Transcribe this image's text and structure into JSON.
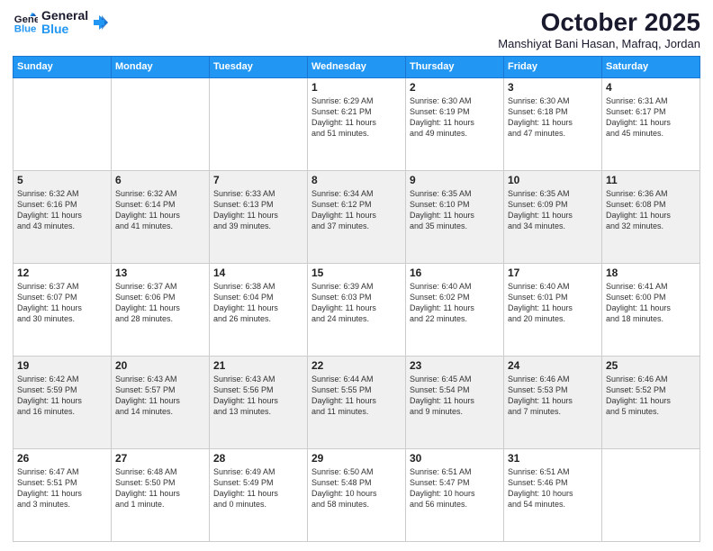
{
  "logo": {
    "line1": "General",
    "line2": "Blue"
  },
  "title": "October 2025",
  "subtitle": "Manshiyat Bani Hasan, Mafraq, Jordan",
  "weekdays": [
    "Sunday",
    "Monday",
    "Tuesday",
    "Wednesday",
    "Thursday",
    "Friday",
    "Saturday"
  ],
  "weeks": [
    [
      {
        "day": "",
        "info": ""
      },
      {
        "day": "",
        "info": ""
      },
      {
        "day": "",
        "info": ""
      },
      {
        "day": "1",
        "info": "Sunrise: 6:29 AM\nSunset: 6:21 PM\nDaylight: 11 hours\nand 51 minutes."
      },
      {
        "day": "2",
        "info": "Sunrise: 6:30 AM\nSunset: 6:19 PM\nDaylight: 11 hours\nand 49 minutes."
      },
      {
        "day": "3",
        "info": "Sunrise: 6:30 AM\nSunset: 6:18 PM\nDaylight: 11 hours\nand 47 minutes."
      },
      {
        "day": "4",
        "info": "Sunrise: 6:31 AM\nSunset: 6:17 PM\nDaylight: 11 hours\nand 45 minutes."
      }
    ],
    [
      {
        "day": "5",
        "info": "Sunrise: 6:32 AM\nSunset: 6:16 PM\nDaylight: 11 hours\nand 43 minutes."
      },
      {
        "day": "6",
        "info": "Sunrise: 6:32 AM\nSunset: 6:14 PM\nDaylight: 11 hours\nand 41 minutes."
      },
      {
        "day": "7",
        "info": "Sunrise: 6:33 AM\nSunset: 6:13 PM\nDaylight: 11 hours\nand 39 minutes."
      },
      {
        "day": "8",
        "info": "Sunrise: 6:34 AM\nSunset: 6:12 PM\nDaylight: 11 hours\nand 37 minutes."
      },
      {
        "day": "9",
        "info": "Sunrise: 6:35 AM\nSunset: 6:10 PM\nDaylight: 11 hours\nand 35 minutes."
      },
      {
        "day": "10",
        "info": "Sunrise: 6:35 AM\nSunset: 6:09 PM\nDaylight: 11 hours\nand 34 minutes."
      },
      {
        "day": "11",
        "info": "Sunrise: 6:36 AM\nSunset: 6:08 PM\nDaylight: 11 hours\nand 32 minutes."
      }
    ],
    [
      {
        "day": "12",
        "info": "Sunrise: 6:37 AM\nSunset: 6:07 PM\nDaylight: 11 hours\nand 30 minutes."
      },
      {
        "day": "13",
        "info": "Sunrise: 6:37 AM\nSunset: 6:06 PM\nDaylight: 11 hours\nand 28 minutes."
      },
      {
        "day": "14",
        "info": "Sunrise: 6:38 AM\nSunset: 6:04 PM\nDaylight: 11 hours\nand 26 minutes."
      },
      {
        "day": "15",
        "info": "Sunrise: 6:39 AM\nSunset: 6:03 PM\nDaylight: 11 hours\nand 24 minutes."
      },
      {
        "day": "16",
        "info": "Sunrise: 6:40 AM\nSunset: 6:02 PM\nDaylight: 11 hours\nand 22 minutes."
      },
      {
        "day": "17",
        "info": "Sunrise: 6:40 AM\nSunset: 6:01 PM\nDaylight: 11 hours\nand 20 minutes."
      },
      {
        "day": "18",
        "info": "Sunrise: 6:41 AM\nSunset: 6:00 PM\nDaylight: 11 hours\nand 18 minutes."
      }
    ],
    [
      {
        "day": "19",
        "info": "Sunrise: 6:42 AM\nSunset: 5:59 PM\nDaylight: 11 hours\nand 16 minutes."
      },
      {
        "day": "20",
        "info": "Sunrise: 6:43 AM\nSunset: 5:57 PM\nDaylight: 11 hours\nand 14 minutes."
      },
      {
        "day": "21",
        "info": "Sunrise: 6:43 AM\nSunset: 5:56 PM\nDaylight: 11 hours\nand 13 minutes."
      },
      {
        "day": "22",
        "info": "Sunrise: 6:44 AM\nSunset: 5:55 PM\nDaylight: 11 hours\nand 11 minutes."
      },
      {
        "day": "23",
        "info": "Sunrise: 6:45 AM\nSunset: 5:54 PM\nDaylight: 11 hours\nand 9 minutes."
      },
      {
        "day": "24",
        "info": "Sunrise: 6:46 AM\nSunset: 5:53 PM\nDaylight: 11 hours\nand 7 minutes."
      },
      {
        "day": "25",
        "info": "Sunrise: 6:46 AM\nSunset: 5:52 PM\nDaylight: 11 hours\nand 5 minutes."
      }
    ],
    [
      {
        "day": "26",
        "info": "Sunrise: 6:47 AM\nSunset: 5:51 PM\nDaylight: 11 hours\nand 3 minutes."
      },
      {
        "day": "27",
        "info": "Sunrise: 6:48 AM\nSunset: 5:50 PM\nDaylight: 11 hours\nand 1 minute."
      },
      {
        "day": "28",
        "info": "Sunrise: 6:49 AM\nSunset: 5:49 PM\nDaylight: 11 hours\nand 0 minutes."
      },
      {
        "day": "29",
        "info": "Sunrise: 6:50 AM\nSunset: 5:48 PM\nDaylight: 10 hours\nand 58 minutes."
      },
      {
        "day": "30",
        "info": "Sunrise: 6:51 AM\nSunset: 5:47 PM\nDaylight: 10 hours\nand 56 minutes."
      },
      {
        "day": "31",
        "info": "Sunrise: 6:51 AM\nSunset: 5:46 PM\nDaylight: 10 hours\nand 54 minutes."
      },
      {
        "day": "",
        "info": ""
      }
    ]
  ]
}
